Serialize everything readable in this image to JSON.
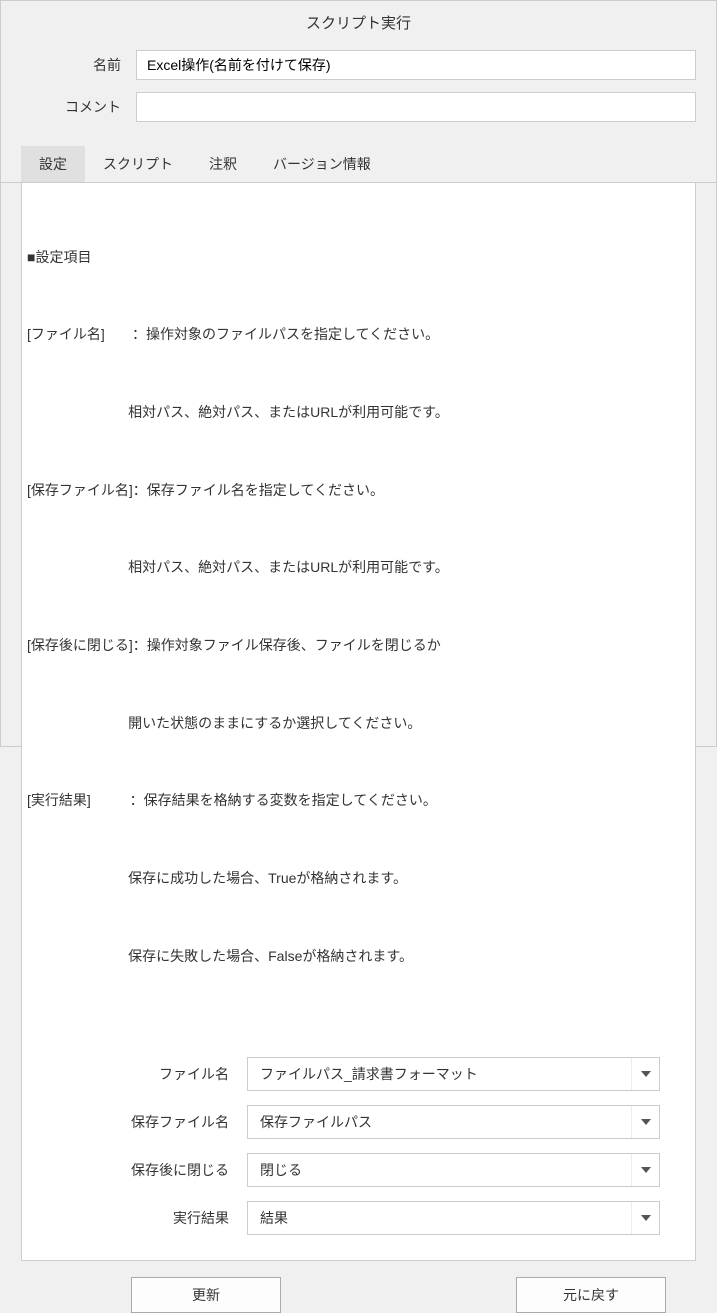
{
  "dialog": {
    "title": "スクリプト実行"
  },
  "fields": {
    "name": {
      "label": "名前",
      "value": "Excel操作(名前を付けて保存)"
    },
    "comment": {
      "label": "コメント",
      "value": ""
    }
  },
  "tabs": {
    "settings": "設定",
    "script": "スクリプト",
    "annotation": "注釈",
    "version": "バージョン情報"
  },
  "settings_description": {
    "header": "■設定項目",
    "line1": "[ファイル名]       ：操作対象のファイルパスを指定してください。",
    "line2": "                          相対パス、絶対パス、またはURLが利用可能です。",
    "line3": "[保存ファイル名]：保存ファイル名を指定してください。",
    "line4": "                          相対パス、絶対パス、またはURLが利用可能です。",
    "line5": "[保存後に閉じる]：操作対象ファイル保存後、ファイルを閉じるか",
    "line6": "                          開いた状態のままにするか選択してください。",
    "line7": "[実行結果]          ：保存結果を格納する変数を指定してください。",
    "line8": "                          保存に成功した場合、Trueが格納されます。",
    "line9": "                          保存に失敗した場合、Falseが格納されます。"
  },
  "params": {
    "filename": {
      "label": "ファイル名",
      "value": "ファイルパス_請求書フォーマット"
    },
    "save_filename": {
      "label": "保存ファイル名",
      "value": "保存ファイルパス"
    },
    "close_after_save": {
      "label": "保存後に閉じる",
      "value": "閉じる"
    },
    "result": {
      "label": "実行結果",
      "value": "結果"
    }
  },
  "buttons": {
    "update": "更新",
    "revert": "元に戻す"
  }
}
